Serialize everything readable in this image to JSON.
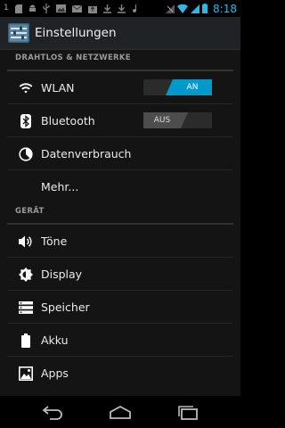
{
  "status_bar": {
    "notification_count": "1",
    "time": "8:18",
    "icons": [
      "notification-icon",
      "sd-card-icon",
      "android-icon",
      "usb-icon",
      "image-icon",
      "mail-icon",
      "upload-icon",
      "download-icon",
      "download-icon",
      "sound-icon",
      "no-signal-icon",
      "wifi-icon",
      "signal-icon",
      "battery-icon"
    ]
  },
  "action_bar": {
    "title": "Einstellungen",
    "icon": "settings-app-icon"
  },
  "sections": {
    "wireless": {
      "header": "DRAHTLOS & NETZWERKE",
      "items": [
        {
          "label": "WLAN",
          "icon": "wifi-icon",
          "toggle": "AN",
          "toggle_state": "on"
        },
        {
          "label": "Bluetooth",
          "icon": "bluetooth-icon",
          "toggle": "AUS",
          "toggle_state": "off"
        },
        {
          "label": "Datenverbrauch",
          "icon": "data-usage-icon"
        },
        {
          "label": "Mehr..."
        }
      ]
    },
    "device": {
      "header": "GERÄT",
      "items": [
        {
          "label": "Töne",
          "icon": "sound-icon"
        },
        {
          "label": "Display",
          "icon": "brightness-icon"
        },
        {
          "label": "Speicher",
          "icon": "storage-icon"
        },
        {
          "label": "Akku",
          "icon": "battery-icon"
        },
        {
          "label": "Apps",
          "icon": "apps-icon"
        }
      ]
    }
  },
  "nav_bar": {
    "buttons": [
      "back-icon",
      "home-icon",
      "recent-apps-icon"
    ]
  },
  "colors": {
    "accent": "#33b5e5",
    "toggle_on": "#0099cc",
    "toggle_off": "#4d4d4d",
    "background": "#141414"
  }
}
